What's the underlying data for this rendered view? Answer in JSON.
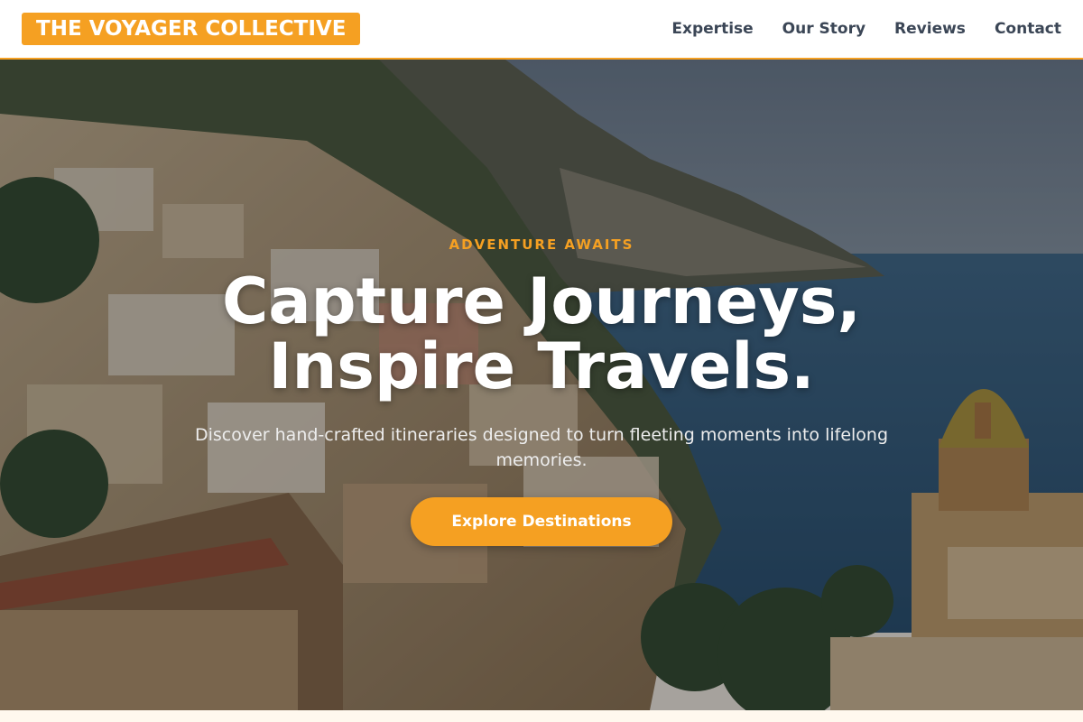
{
  "header": {
    "logo_text": "THE VOYAGER COLLECTIVE",
    "nav": [
      {
        "label": "Expertise"
      },
      {
        "label": "Our Story"
      },
      {
        "label": "Reviews"
      },
      {
        "label": "Contact"
      }
    ]
  },
  "hero": {
    "eyebrow": "ADVENTURE AWAITS",
    "headline_line1": "Capture Journeys,",
    "headline_line2": "Inspire Travels.",
    "subtext": "Discover hand-crafted itineraries designed to turn fleeting moments into lifelong memories.",
    "cta_label": "Explore Destinations",
    "background_scene": "coastal-cliffside-village-photo"
  },
  "colors": {
    "accent": "#f5a022",
    "nav_text": "#3b4656",
    "header_bg": "#ffffff",
    "page_bg": "#fff8ee"
  }
}
